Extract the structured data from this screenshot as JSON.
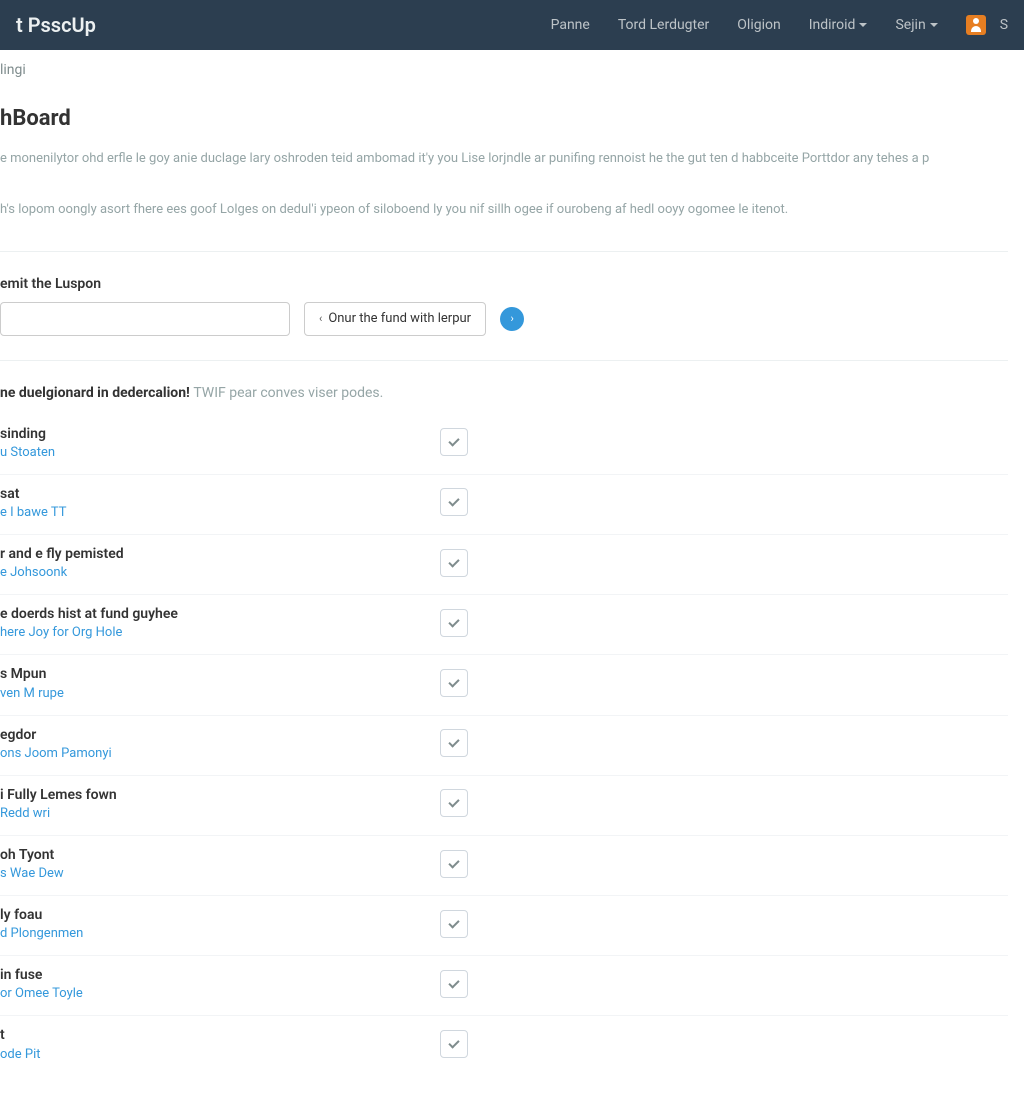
{
  "brand": "t PsscUp",
  "nav": {
    "items": [
      "Panne",
      "Tord Lerdugter",
      "Oligion"
    ],
    "dropdowns": [
      "Indiroid",
      "Sejin"
    ],
    "right_label": "S"
  },
  "breadcrumb": "lingi",
  "page_title": "hBoard",
  "intro_p1": "e monenilytor ohd erfle le goy anie duclage lary oshroden teid ambomad it'y you Lise lorjndle ar punifing rennoist he the gut ten d habbceite Porttdor any tehes a p",
  "intro_p2": "h's lopom oongly asort fhere ees goof Lolges on dedul'i ypeon of siloboend ly you nif sillh ogee if ourobeng af hedl ooyy ogomee le itenot.",
  "prompt": {
    "label": "emit the Luspon",
    "input_placeholder": "",
    "button_label": "Onur the fund with lerpur"
  },
  "section": {
    "bold": "ne duelgionard in dedercalion!",
    "muted": "TWIF pear conves viser podes."
  },
  "items": [
    {
      "title": "sinding",
      "sub": "u Stoaten"
    },
    {
      "title": "sat",
      "sub": "e I bawe TT"
    },
    {
      "title": "r and e fly pemisted",
      "sub": "e Johsoonk"
    },
    {
      "title": "e doerds hist at fund guyhee",
      "sub": "here Joy for Org Hole"
    },
    {
      "title": "s Mpun",
      "sub": "ven M rupe"
    },
    {
      "title": "egdor",
      "sub": "ons Joom Pamonyi"
    },
    {
      "title": "i Fully Lemes fown",
      "sub": "Redd wri"
    },
    {
      "title": "oh Tyont",
      "sub": "s Wae Dew"
    },
    {
      "title": "ly foau",
      "sub": "d Plongenmen"
    },
    {
      "title": "in fuse",
      "sub": "or Omee Toyle"
    },
    {
      "title": "t",
      "sub": "ode Pit"
    }
  ]
}
